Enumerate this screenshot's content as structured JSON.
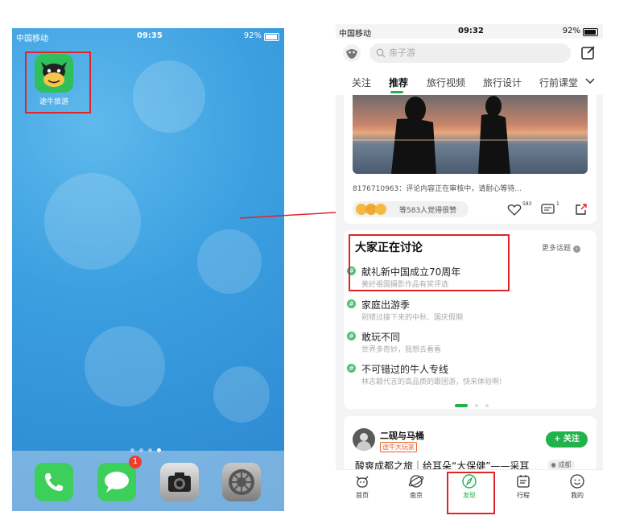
{
  "left_phone": {
    "status": {
      "carrier": "中国移动",
      "time": "09:35",
      "battery": "92%"
    },
    "app_label": "途牛旅游",
    "page_indicator": {
      "count": 4,
      "active": 3
    },
    "dock": {
      "apps": [
        "phone-icon",
        "messages-icon",
        "camera-icon",
        "settings-icon"
      ],
      "messages_badge": "1"
    }
  },
  "right_phone": {
    "status": {
      "carrier": "中国移动",
      "time": "09:32",
      "battery": "92%"
    },
    "search": {
      "placeholder": "亲子游"
    },
    "tabs": [
      "关注",
      "推荐",
      "旅行视频",
      "旅行设计",
      "行前课堂"
    ],
    "active_tab": "推荐",
    "post": {
      "comment": "8176710963：评论内容正在审核中，请耐心等待...",
      "likes_text": "等583人觉得很赞",
      "like_count": "583",
      "comment_count": "1"
    },
    "discussion": {
      "title": "大家正在讨论",
      "more": "更多话题",
      "topics": [
        {
          "title": "献礼新中国成立70周年",
          "subtitle": "美好祖国摄影作品有奖评选"
        },
        {
          "title": "家庭出游季",
          "subtitle": "别错过接下来的中秋、国庆假期"
        },
        {
          "title": "敢玩不同",
          "subtitle": "世界多奇妙，我想去看看"
        },
        {
          "title": "不可错过的牛人专线",
          "subtitle": "林志颖代言的高品质的跟团游，快来体验啊!"
        }
      ]
    },
    "user_card": {
      "name": "二砚与马桶",
      "tag": "途牛大玩家",
      "follow": "+ 关注",
      "headline": "酸爽成都之旅｜给耳朵“大保健”——采耳",
      "location": "成都"
    },
    "nav": [
      {
        "label": "首页",
        "icon": "cow-icon"
      },
      {
        "label": "南京",
        "icon": "globe-icon"
      },
      {
        "label": "发现",
        "icon": "compass-icon"
      },
      {
        "label": "行程",
        "icon": "calendar-icon"
      },
      {
        "label": "我的",
        "icon": "smile-icon"
      }
    ],
    "active_nav": "发现",
    "accent_color": "#21b24c"
  },
  "annotation": {
    "box_color": "#e0242a"
  }
}
